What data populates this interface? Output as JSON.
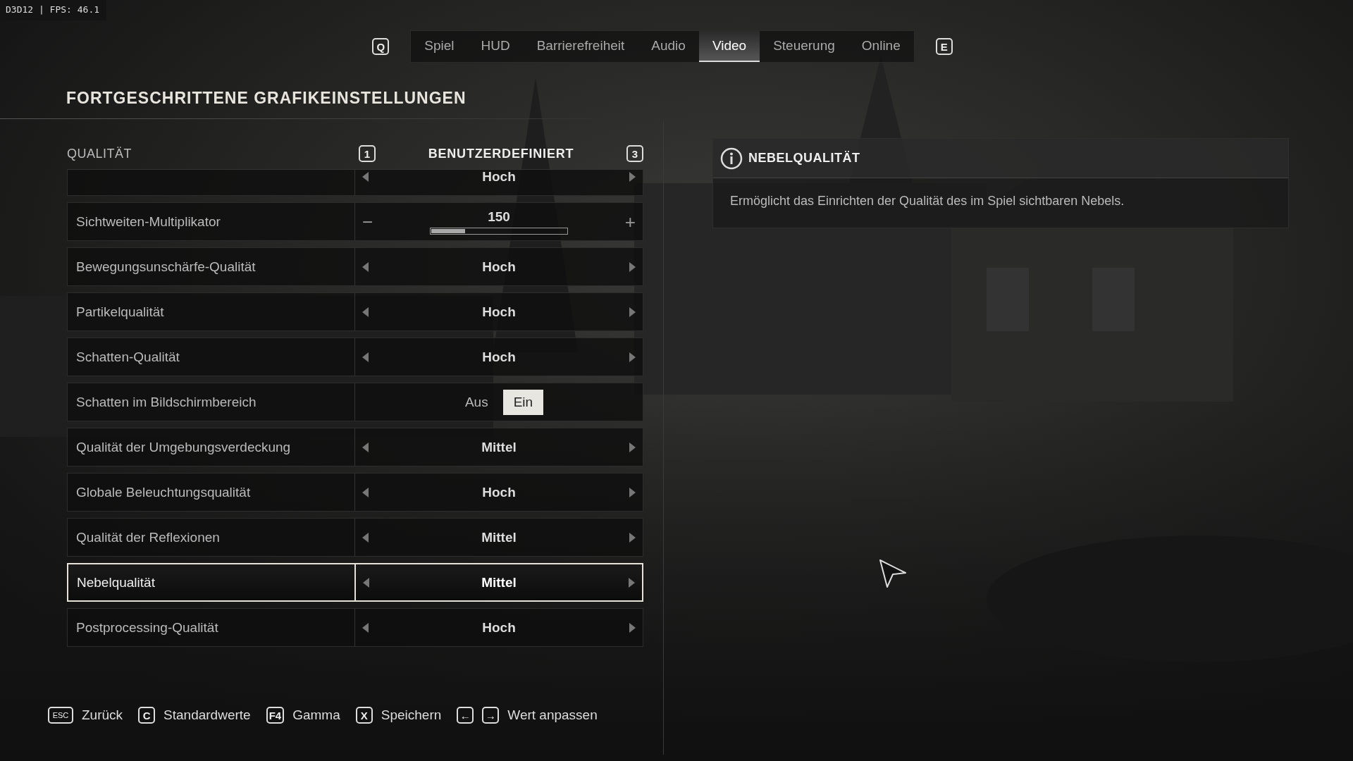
{
  "debug_overlay": "D3D12 | FPS:  46.1",
  "tabs_bar": {
    "prev_key": "Q",
    "next_key": "E",
    "tabs": [
      {
        "label": "Spiel",
        "selected": false
      },
      {
        "label": "HUD",
        "selected": false
      },
      {
        "label": "Barrierefreiheit",
        "selected": false
      },
      {
        "label": "Audio",
        "selected": false
      },
      {
        "label": "Video",
        "selected": true
      },
      {
        "label": "Steuerung",
        "selected": false
      },
      {
        "label": "Online",
        "selected": false
      }
    ]
  },
  "title": "FORTGESCHRITTENE GRAFIKEINSTELLUNGEN",
  "quality": {
    "label": "QUALITÄT",
    "prev_key": "1",
    "value": "BENUTZERDEFINIERT",
    "next_key": "3"
  },
  "settings": [
    {
      "kind": "selector",
      "value": "Hoch",
      "selected": false
    },
    {
      "kind": "slider",
      "label": "Sichtweiten-Multiplikator",
      "value": "150",
      "minus": "−",
      "plus": "+",
      "level": 0.25,
      "selected": false
    },
    {
      "kind": "selector",
      "label": "Bewegungsunschärfe-Qualität",
      "value": "Hoch",
      "selected": false
    },
    {
      "kind": "selector",
      "label": "Partikelqualität",
      "value": "Hoch",
      "selected": false
    },
    {
      "kind": "selector",
      "label": "Schatten-Qualität",
      "value": "Hoch",
      "selected": false
    },
    {
      "kind": "toggle",
      "label": "Schatten im Bildschirmbereich",
      "options": [
        {
          "label": "Aus",
          "selected": false
        },
        {
          "label": "Ein",
          "selected": true
        }
      ],
      "selected": false
    },
    {
      "kind": "selector",
      "label": "Qualität der Umgebungsverdeckung",
      "value": "Mittel",
      "selected": false
    },
    {
      "kind": "selector",
      "label": "Globale Beleuchtungsqualität",
      "value": "Hoch",
      "selected": false
    },
    {
      "kind": "selector",
      "label": "Qualität der Reflexionen",
      "value": "Mittel",
      "selected": false
    },
    {
      "kind": "selector",
      "label": "Nebelqualität",
      "value": "Mittel",
      "selected": true
    },
    {
      "kind": "selector",
      "label": "Postprocessing-Qualität",
      "value": "Hoch",
      "selected": false
    }
  ],
  "info_panel": {
    "title": "NEBELQUALITÄT",
    "text": "Ermöglicht das Einrichten der Qualität des im Spiel sichtbaren Nebels."
  },
  "footer": [
    {
      "keys": [
        "ESC"
      ],
      "label": "Zurück"
    },
    {
      "keys": [
        "C"
      ],
      "label": "Standardwerte"
    },
    {
      "keys": [
        "F4"
      ],
      "label": "Gamma"
    },
    {
      "keys": [
        "X"
      ],
      "label": "Speichern"
    },
    {
      "keys": [
        "←",
        "→"
      ],
      "label": "Wert anpassen"
    }
  ]
}
